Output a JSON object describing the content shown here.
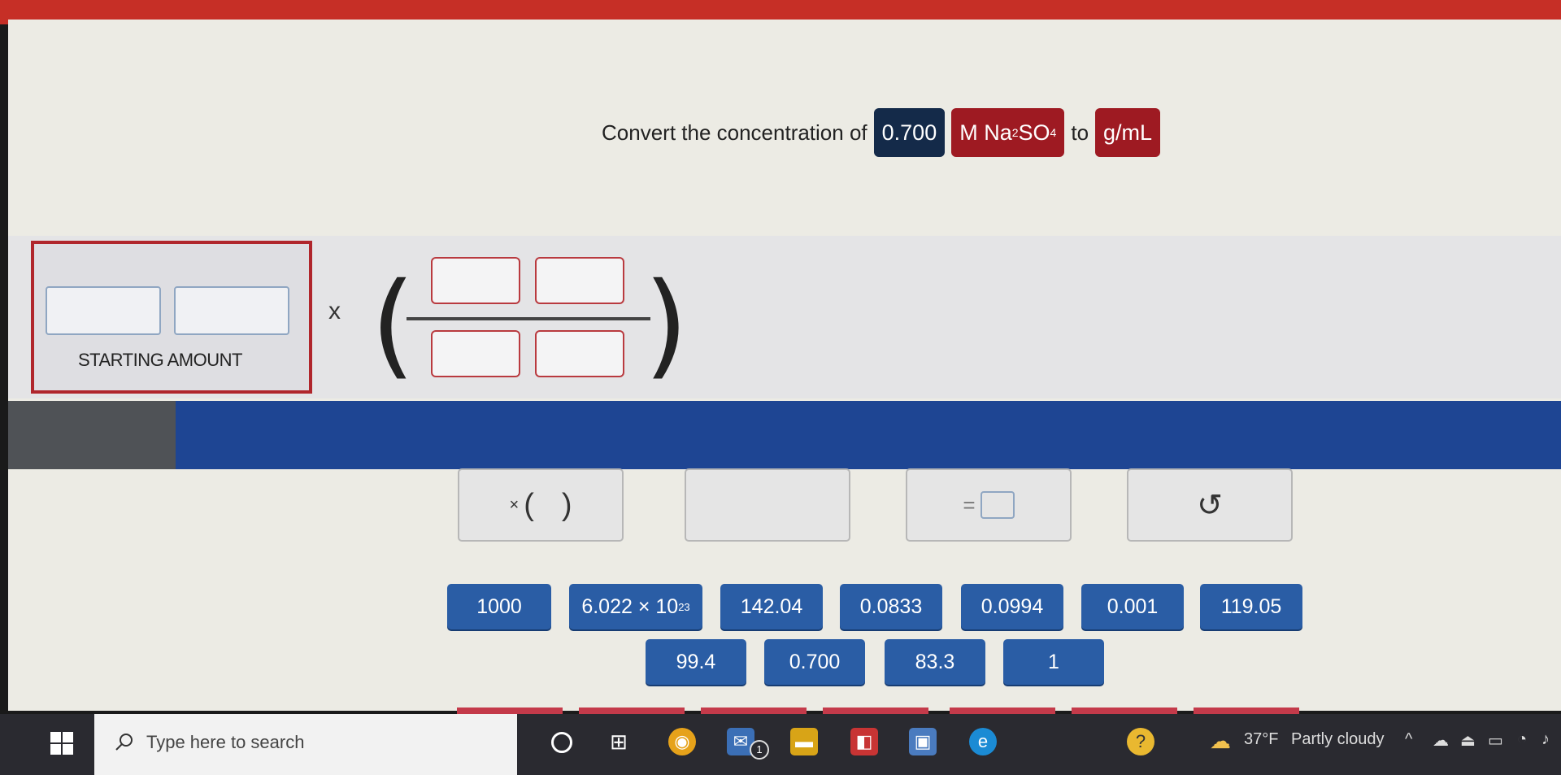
{
  "prompt": {
    "lead": "Convert the concentration of",
    "value": "0.700",
    "unit_prefix": "M Na",
    "sub2": "2",
    "unit_mid": "SO",
    "sub4": "4",
    "connector": "to",
    "target_unit": "g/mL"
  },
  "workspace": {
    "starting_label": "STARTING AMOUNT",
    "times_symbol": "x"
  },
  "tools": {
    "multiply_paren": {
      "x": "×",
      "open": "(",
      "close": ")"
    },
    "undo_symbol": "↺"
  },
  "tiles_row1": [
    {
      "label": "1000"
    },
    {
      "label": "6.022 × 10",
      "sup": "23"
    },
    {
      "label": "142.04"
    },
    {
      "label": "0.0833"
    },
    {
      "label": "0.0994"
    },
    {
      "label": "0.001"
    },
    {
      "label": "119.05"
    }
  ],
  "tiles_row2": [
    {
      "label": "99.4"
    },
    {
      "label": "0.700"
    },
    {
      "label": "83.3"
    },
    {
      "label": "1"
    }
  ],
  "taskbar": {
    "search_placeholder": "Type here to search",
    "weather_temp": "37°F",
    "weather_desc": "Partly cloudy",
    "mail_badge": "1"
  },
  "colors": {
    "accent_red": "#9e1a22",
    "navy": "#142a49",
    "tile_blue": "#2a5da5",
    "bar_blue": "#1e4593"
  }
}
